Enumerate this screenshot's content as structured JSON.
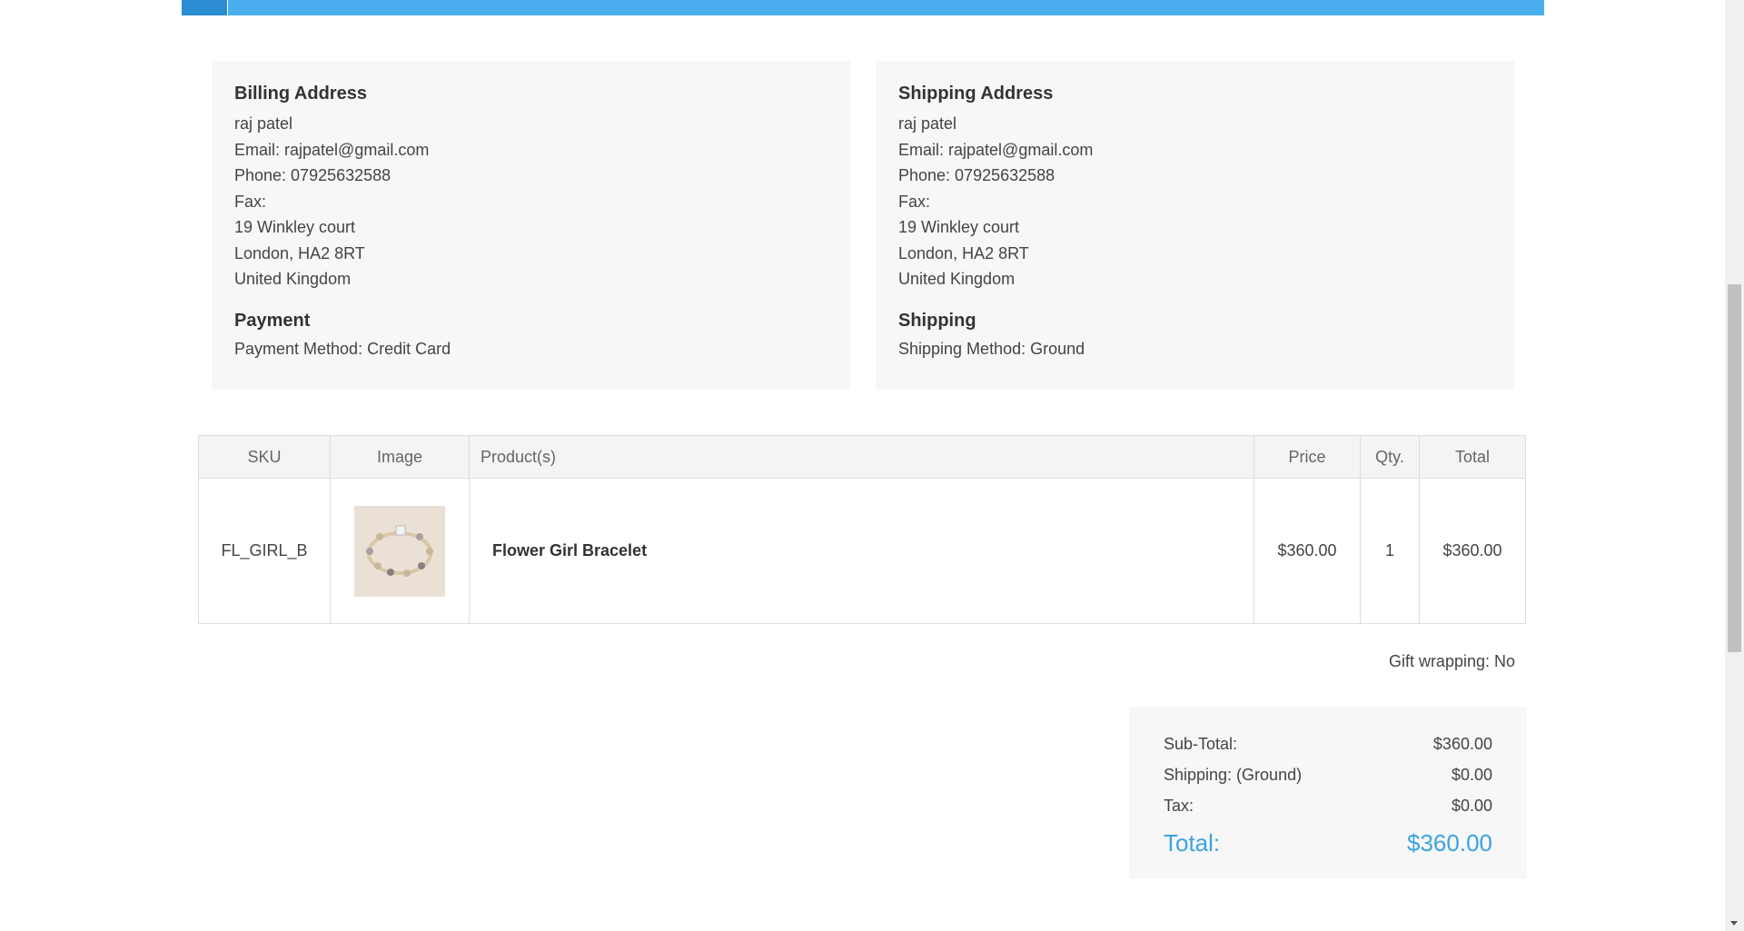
{
  "billing": {
    "title": "Billing Address",
    "name": "raj patel",
    "email": "Email: rajpatel@gmail.com",
    "phone": "Phone: 07925632588",
    "fax": "Fax:",
    "street": "19 Winkley court",
    "city": "London, HA2 8RT",
    "country": "United Kingdom"
  },
  "payment": {
    "title": "Payment",
    "method": "Payment Method: Credit Card"
  },
  "shipping_address": {
    "title": "Shipping Address",
    "name": "raj patel",
    "email": "Email: rajpatel@gmail.com",
    "phone": "Phone: 07925632588",
    "fax": "Fax:",
    "street": "19 Winkley court",
    "city": "London, HA2 8RT",
    "country": "United Kingdom"
  },
  "shipping": {
    "title": "Shipping",
    "method": "Shipping Method: Ground"
  },
  "table": {
    "headers": {
      "sku": "SKU",
      "image": "Image",
      "products": "Product(s)",
      "price": "Price",
      "qty": "Qty.",
      "total": "Total"
    },
    "rows": [
      {
        "sku": "FL_GIRL_B",
        "image_icon": "bracelet-thumbnail",
        "product": "Flower Girl Bracelet",
        "price": "$360.00",
        "qty": "1",
        "total": "$360.00"
      }
    ]
  },
  "gift_wrapping": "Gift wrapping: No",
  "totals": {
    "subtotal_label": "Sub-Total:",
    "subtotal_value": "$360.00",
    "shipping_label": "Shipping: (Ground)",
    "shipping_value": "$0.00",
    "tax_label": "Tax:",
    "tax_value": "$0.00",
    "total_label": "Total:",
    "total_value": "$360.00"
  },
  "colors": {
    "header_band": "#4aaeee",
    "header_tab": "#2a8cd1",
    "total_accent": "#3aa3e3",
    "box_background": "#f7f7f7"
  }
}
